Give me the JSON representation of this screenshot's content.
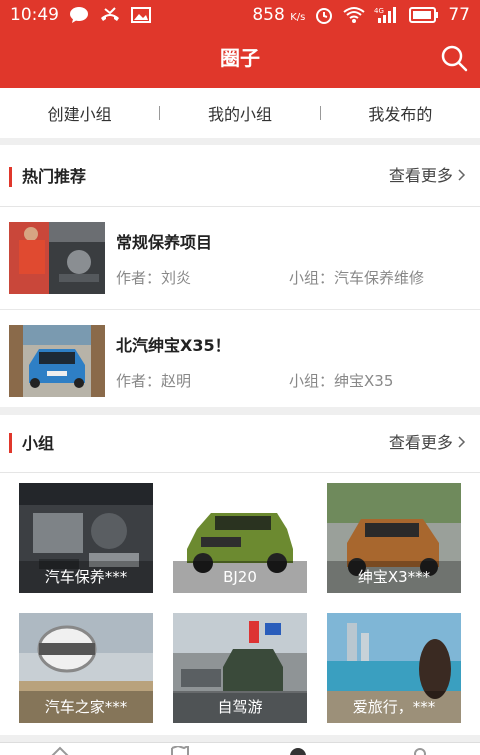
{
  "status": {
    "time": "10:49",
    "speed": "858",
    "speed_unit": "K/s",
    "battery": "77"
  },
  "appbar": {
    "title": "圈子"
  },
  "tabs": [
    "创建小组",
    "我的小组",
    "我发布的"
  ],
  "hot": {
    "title": "热门推荐",
    "more": "查看更多",
    "items": [
      {
        "title": "常规保养项目",
        "author": "作者：刘炎",
        "group": "小组：汽车保养维修"
      },
      {
        "title": "北汽绅宝X35！",
        "author": "作者：赵明",
        "group": "小组：绅宝X35"
      }
    ]
  },
  "groups": {
    "title": "小组",
    "more": "查看更多",
    "tiles": [
      "汽车保养***",
      "BJ20",
      "绅宝X3***",
      "汽车之家***",
      "自驾游",
      "爱旅行，***"
    ]
  }
}
